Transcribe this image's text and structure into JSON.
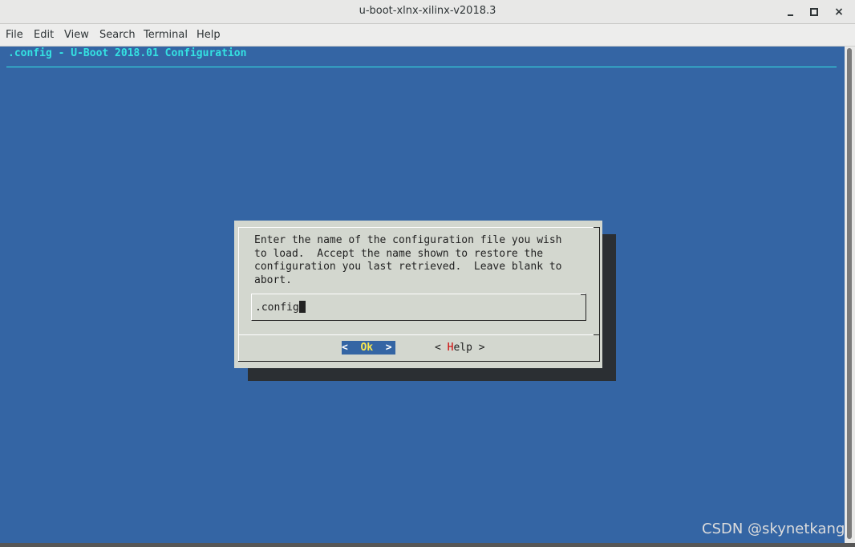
{
  "window": {
    "title": "u-boot-xlnx-xilinx-v2018.3",
    "controls": [
      "minimize-icon",
      "maximize-icon",
      "close-icon"
    ],
    "close_glyph": "×"
  },
  "menubar": {
    "items": [
      "File",
      "Edit",
      "View",
      "Search",
      "Terminal",
      "Help"
    ]
  },
  "terminal": {
    "header": ".config - U-Boot 2018.01 Configuration",
    "background": "#3465a4",
    "header_color": "#34e2e2"
  },
  "dialog": {
    "prompt": "Enter the name of the configuration file you wish\nto load.  Accept the name shown to restore the\nconfiguration you last retrieved.  Leave blank to\nabort.",
    "input_value": ".config",
    "ok_left": "<  ",
    "ok_label": "Ok",
    "ok_right": "  >",
    "help_left": "< ",
    "help_hotkey": "H",
    "help_rest": "elp >",
    "background": "#d3d7cf",
    "selected_color": "#3465a4",
    "hotkey_color": "#cc0000"
  },
  "watermark": "CSDN @skynetkang"
}
